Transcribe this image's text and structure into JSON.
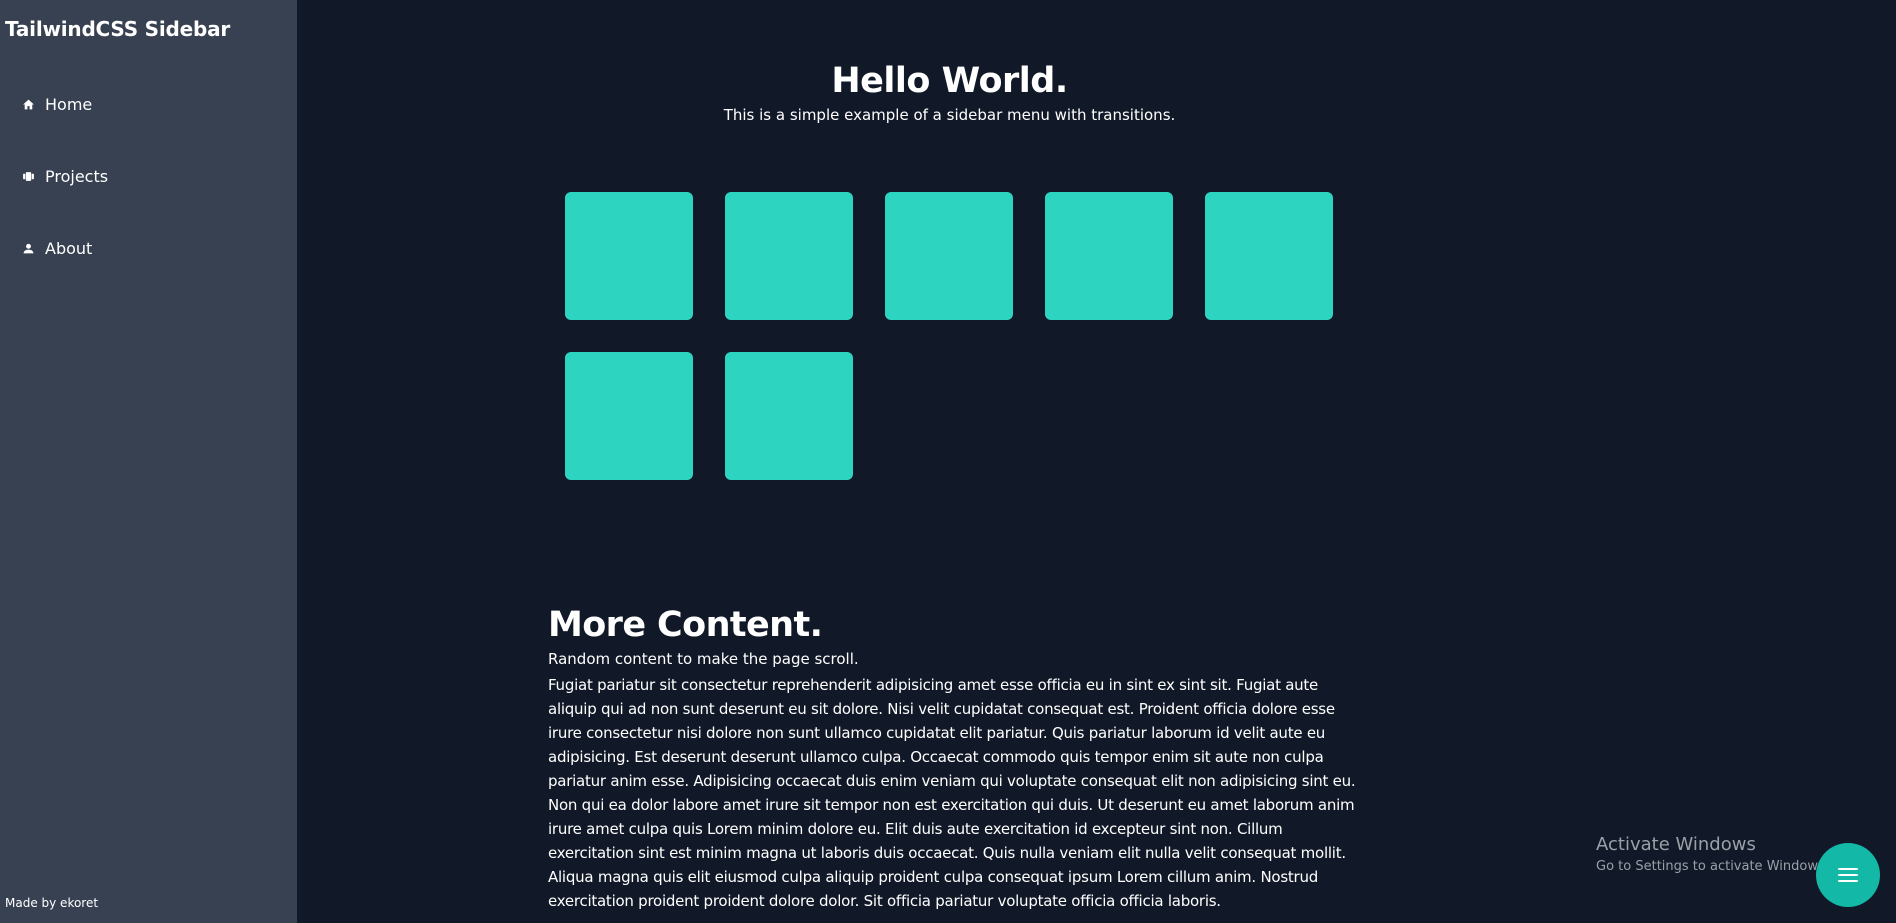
{
  "sidebar": {
    "brand": "TailwindCSS Sidebar",
    "items": [
      {
        "label": "Home",
        "icon": "home-icon"
      },
      {
        "label": "Projects",
        "icon": "projects-icon"
      },
      {
        "label": "About",
        "icon": "user-icon"
      }
    ],
    "credit": "Made by ekoret"
  },
  "hero": {
    "title": "Hello World.",
    "subtitle": "This is a simple example of a sidebar menu with transitions."
  },
  "tiles": {
    "count": 7,
    "color": "#2dd4bf"
  },
  "more": {
    "title": "More Content.",
    "subtitle": "Random content to make the page scroll.",
    "body": "Fugiat pariatur sit consectetur reprehenderit adipisicing amet esse officia eu in sint ex sint sit. Fugiat aute aliquip qui ad non sunt deserunt eu sit dolore. Nisi velit cupidatat consequat est. Proident officia dolore esse irure consectetur nisi dolore non sunt ullamco cupidatat elit pariatur. Quis pariatur laborum id velit aute eu adipisicing. Est deserunt deserunt ullamco culpa. Occaecat commodo quis tempor enim sit aute non culpa pariatur anim esse. Adipisicing occaecat duis enim veniam qui voluptate consequat elit non adipisicing sint eu. Non qui ea dolor labore amet irure sit tempor non est exercitation qui duis. Ut deserunt eu amet laborum anim irure amet culpa quis Lorem minim dolore eu. Elit duis aute exercitation id excepteur sint non. Cillum exercitation sint est minim magna ut laboris duis occaecat. Quis nulla veniam elit nulla velit consequat mollit. Aliqua magna quis elit eiusmod culpa aliquip proident culpa consequat ipsum Lorem cillum anim. Nostrud exercitation proident proident dolore dolor. Sit officia pariatur voluptate officia officia laboris."
  },
  "watermark": {
    "title": "Activate Windows",
    "subtitle": "Go to Settings to activate Windows."
  },
  "fab": {
    "icon": "menu-icon"
  },
  "colors": {
    "page_bg": "#111827",
    "sidebar_bg": "#374151",
    "accent": "#2dd4bf",
    "fab": "#14b8a6"
  }
}
